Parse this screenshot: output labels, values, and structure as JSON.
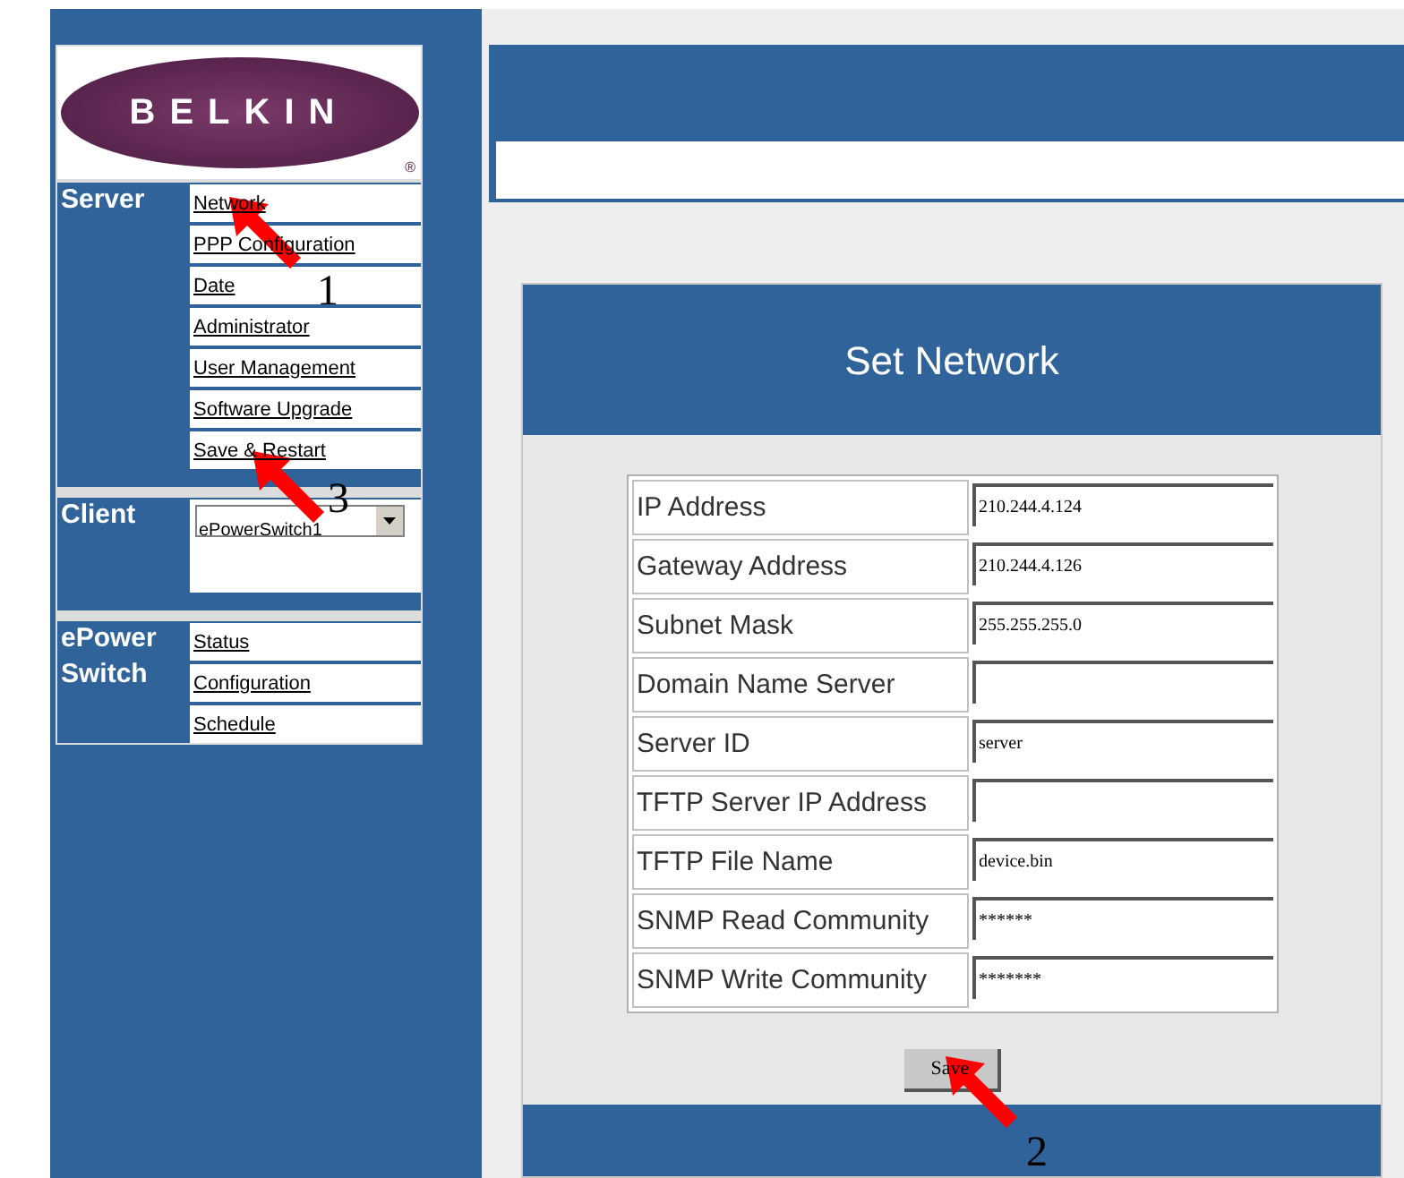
{
  "logo": {
    "text": "BELKIN",
    "mark": "®"
  },
  "sidebar": {
    "sections": [
      {
        "kind": "links",
        "label": "Server",
        "items": [
          "Network",
          "PPP Configuration",
          "Date",
          "Administrator",
          "User Management",
          "Software Upgrade",
          "Save & Restart"
        ]
      },
      {
        "kind": "select",
        "label": "Client",
        "value": "ePowerSwitch1"
      },
      {
        "kind": "links",
        "label": "ePower Switch",
        "items": [
          "Status",
          "Configuration",
          "Schedule"
        ]
      }
    ]
  },
  "panel": {
    "title": "Set Network",
    "fields": [
      {
        "label": "IP Address",
        "value": "210.244.4.124"
      },
      {
        "label": "Gateway Address",
        "value": "210.244.4.126"
      },
      {
        "label": "Subnet Mask",
        "value": "255.255.255.0"
      },
      {
        "label": "Domain Name Server"
      },
      {
        "label": "Server ID",
        "value": "server"
      },
      {
        "label": "TFTP Server IP Address"
      },
      {
        "label": "TFTP File Name",
        "value": "device.bin"
      },
      {
        "label": "SNMP Read Community",
        "value": "******"
      },
      {
        "label": "SNMP Write Community",
        "value": "*******"
      }
    ],
    "button": "Save"
  },
  "callouts": [
    "1",
    "3",
    "2"
  ]
}
